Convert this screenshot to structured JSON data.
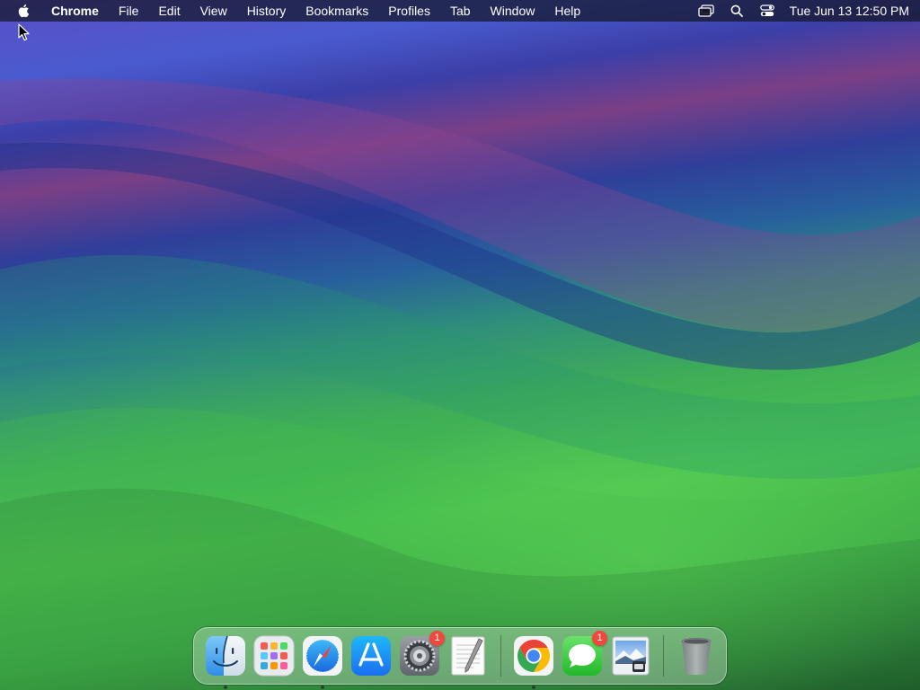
{
  "menubar": {
    "apple_icon": "apple-logo-icon",
    "app_name": "Chrome",
    "menus": [
      "File",
      "Edit",
      "View",
      "History",
      "Bookmarks",
      "Profiles",
      "Tab",
      "Window",
      "Help"
    ],
    "status_icons": [
      "screen-mirroring-icon",
      "spotlight-search-icon",
      "control-center-icon"
    ],
    "clock": "Tue Jun 13  12:50 PM"
  },
  "dock": {
    "apps": [
      {
        "name": "Finder",
        "icon": "finder-icon",
        "running": true,
        "badge": ""
      },
      {
        "name": "Launchpad",
        "icon": "launchpad-icon",
        "running": false,
        "badge": ""
      },
      {
        "name": "Safari",
        "icon": "safari-icon",
        "running": true,
        "badge": ""
      },
      {
        "name": "App Store",
        "icon": "app-store-icon",
        "running": false,
        "badge": ""
      },
      {
        "name": "System Settings",
        "icon": "system-settings-icon",
        "running": false,
        "badge": "1"
      },
      {
        "name": "TextEdit",
        "icon": "textedit-icon",
        "running": false,
        "badge": ""
      }
    ],
    "recent_apps": [
      {
        "name": "Google Chrome",
        "icon": "chrome-icon",
        "running": true,
        "badge": ""
      },
      {
        "name": "Messages",
        "icon": "messages-icon",
        "running": false,
        "badge": "1"
      },
      {
        "name": "Preview",
        "icon": "preview-icon",
        "running": false,
        "badge": ""
      }
    ],
    "trash": {
      "name": "Trash",
      "icon": "trash-icon"
    }
  },
  "colors": {
    "menubar_bg": "#14162a",
    "badge": "#f2473c",
    "wallpaper_green": "#4cc34f",
    "wallpaper_blue": "#4a5bcf",
    "wallpaper_magenta": "#7a3f86"
  }
}
